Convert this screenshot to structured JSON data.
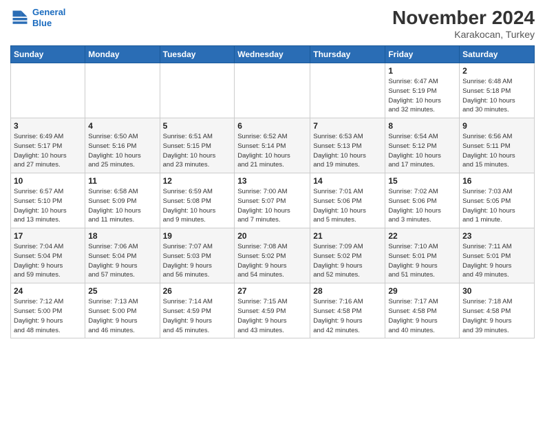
{
  "header": {
    "logo_line1": "General",
    "logo_line2": "Blue",
    "month_title": "November 2024",
    "location": "Karakocan, Turkey"
  },
  "weekdays": [
    "Sunday",
    "Monday",
    "Tuesday",
    "Wednesday",
    "Thursday",
    "Friday",
    "Saturday"
  ],
  "weeks": [
    [
      {
        "day": "",
        "info": ""
      },
      {
        "day": "",
        "info": ""
      },
      {
        "day": "",
        "info": ""
      },
      {
        "day": "",
        "info": ""
      },
      {
        "day": "",
        "info": ""
      },
      {
        "day": "1",
        "info": "Sunrise: 6:47 AM\nSunset: 5:19 PM\nDaylight: 10 hours\nand 32 minutes."
      },
      {
        "day": "2",
        "info": "Sunrise: 6:48 AM\nSunset: 5:18 PM\nDaylight: 10 hours\nand 30 minutes."
      }
    ],
    [
      {
        "day": "3",
        "info": "Sunrise: 6:49 AM\nSunset: 5:17 PM\nDaylight: 10 hours\nand 27 minutes."
      },
      {
        "day": "4",
        "info": "Sunrise: 6:50 AM\nSunset: 5:16 PM\nDaylight: 10 hours\nand 25 minutes."
      },
      {
        "day": "5",
        "info": "Sunrise: 6:51 AM\nSunset: 5:15 PM\nDaylight: 10 hours\nand 23 minutes."
      },
      {
        "day": "6",
        "info": "Sunrise: 6:52 AM\nSunset: 5:14 PM\nDaylight: 10 hours\nand 21 minutes."
      },
      {
        "day": "7",
        "info": "Sunrise: 6:53 AM\nSunset: 5:13 PM\nDaylight: 10 hours\nand 19 minutes."
      },
      {
        "day": "8",
        "info": "Sunrise: 6:54 AM\nSunset: 5:12 PM\nDaylight: 10 hours\nand 17 minutes."
      },
      {
        "day": "9",
        "info": "Sunrise: 6:56 AM\nSunset: 5:11 PM\nDaylight: 10 hours\nand 15 minutes."
      }
    ],
    [
      {
        "day": "10",
        "info": "Sunrise: 6:57 AM\nSunset: 5:10 PM\nDaylight: 10 hours\nand 13 minutes."
      },
      {
        "day": "11",
        "info": "Sunrise: 6:58 AM\nSunset: 5:09 PM\nDaylight: 10 hours\nand 11 minutes."
      },
      {
        "day": "12",
        "info": "Sunrise: 6:59 AM\nSunset: 5:08 PM\nDaylight: 10 hours\nand 9 minutes."
      },
      {
        "day": "13",
        "info": "Sunrise: 7:00 AM\nSunset: 5:07 PM\nDaylight: 10 hours\nand 7 minutes."
      },
      {
        "day": "14",
        "info": "Sunrise: 7:01 AM\nSunset: 5:06 PM\nDaylight: 10 hours\nand 5 minutes."
      },
      {
        "day": "15",
        "info": "Sunrise: 7:02 AM\nSunset: 5:06 PM\nDaylight: 10 hours\nand 3 minutes."
      },
      {
        "day": "16",
        "info": "Sunrise: 7:03 AM\nSunset: 5:05 PM\nDaylight: 10 hours\nand 1 minute."
      }
    ],
    [
      {
        "day": "17",
        "info": "Sunrise: 7:04 AM\nSunset: 5:04 PM\nDaylight: 9 hours\nand 59 minutes."
      },
      {
        "day": "18",
        "info": "Sunrise: 7:06 AM\nSunset: 5:04 PM\nDaylight: 9 hours\nand 57 minutes."
      },
      {
        "day": "19",
        "info": "Sunrise: 7:07 AM\nSunset: 5:03 PM\nDaylight: 9 hours\nand 56 minutes."
      },
      {
        "day": "20",
        "info": "Sunrise: 7:08 AM\nSunset: 5:02 PM\nDaylight: 9 hours\nand 54 minutes."
      },
      {
        "day": "21",
        "info": "Sunrise: 7:09 AM\nSunset: 5:02 PM\nDaylight: 9 hours\nand 52 minutes."
      },
      {
        "day": "22",
        "info": "Sunrise: 7:10 AM\nSunset: 5:01 PM\nDaylight: 9 hours\nand 51 minutes."
      },
      {
        "day": "23",
        "info": "Sunrise: 7:11 AM\nSunset: 5:01 PM\nDaylight: 9 hours\nand 49 minutes."
      }
    ],
    [
      {
        "day": "24",
        "info": "Sunrise: 7:12 AM\nSunset: 5:00 PM\nDaylight: 9 hours\nand 48 minutes."
      },
      {
        "day": "25",
        "info": "Sunrise: 7:13 AM\nSunset: 5:00 PM\nDaylight: 9 hours\nand 46 minutes."
      },
      {
        "day": "26",
        "info": "Sunrise: 7:14 AM\nSunset: 4:59 PM\nDaylight: 9 hours\nand 45 minutes."
      },
      {
        "day": "27",
        "info": "Sunrise: 7:15 AM\nSunset: 4:59 PM\nDaylight: 9 hours\nand 43 minutes."
      },
      {
        "day": "28",
        "info": "Sunrise: 7:16 AM\nSunset: 4:58 PM\nDaylight: 9 hours\nand 42 minutes."
      },
      {
        "day": "29",
        "info": "Sunrise: 7:17 AM\nSunset: 4:58 PM\nDaylight: 9 hours\nand 40 minutes."
      },
      {
        "day": "30",
        "info": "Sunrise: 7:18 AM\nSunset: 4:58 PM\nDaylight: 9 hours\nand 39 minutes."
      }
    ]
  ]
}
